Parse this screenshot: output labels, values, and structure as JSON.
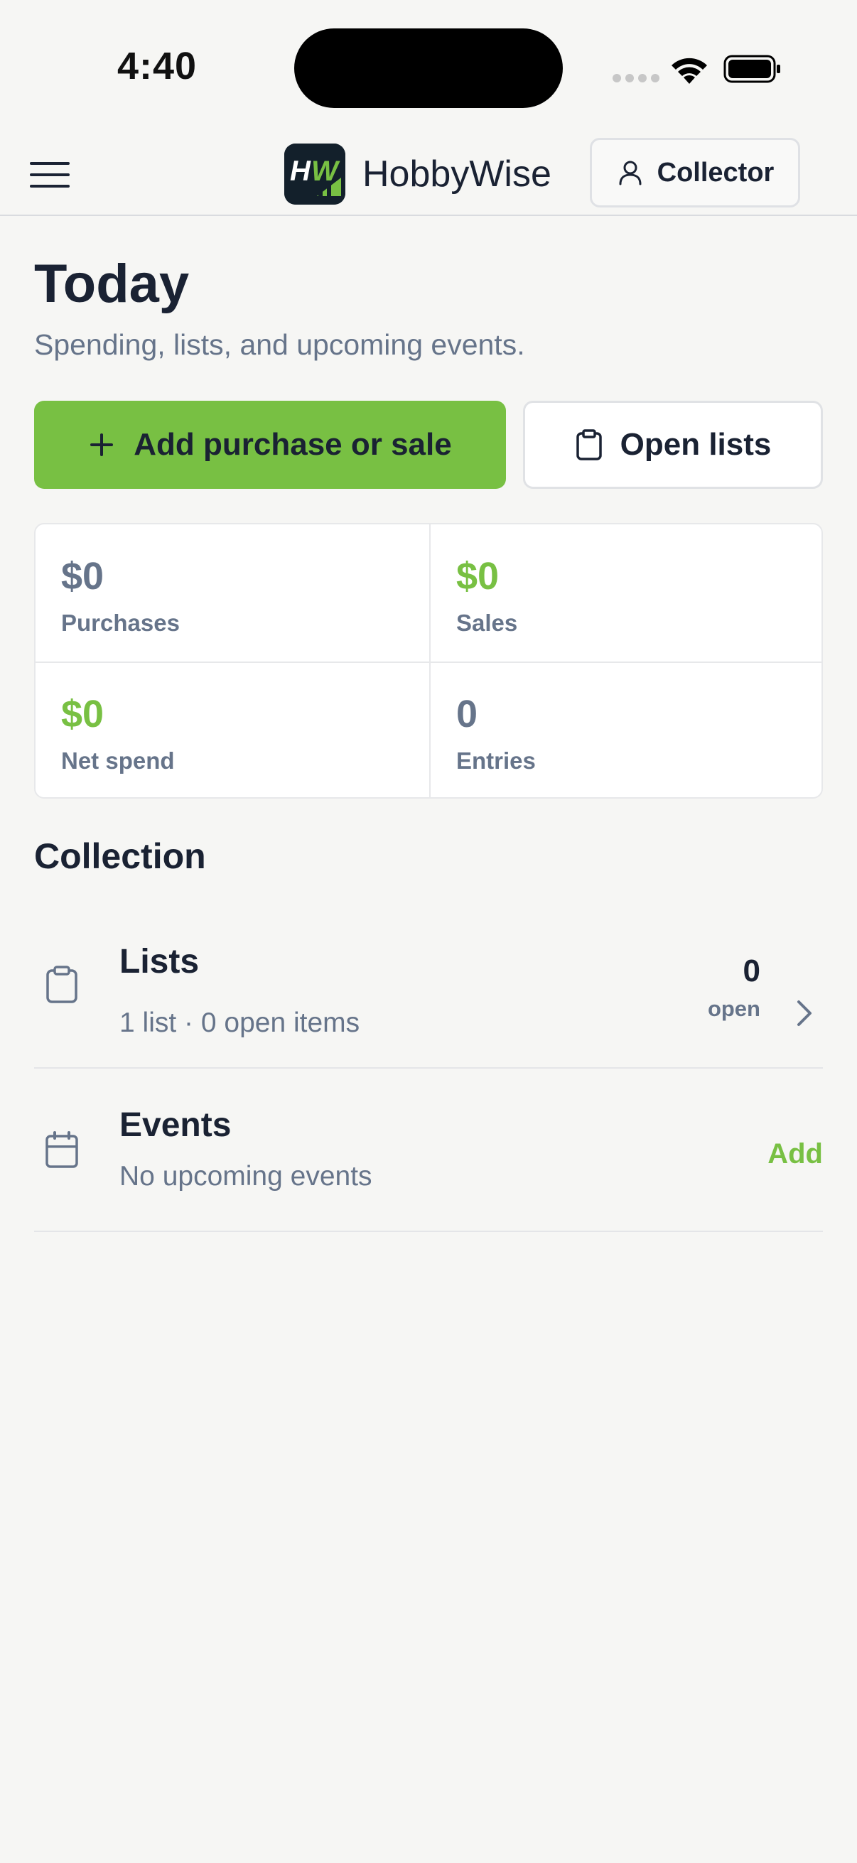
{
  "status_bar": {
    "time": "4:40",
    "icons": [
      "signal-dots-icon",
      "wifi-icon",
      "battery-icon"
    ]
  },
  "header": {
    "menu_icon": "hamburger-menu-icon",
    "logo_text": "HW",
    "app_name": "HobbyWise",
    "profile_button": {
      "icon": "user-icon",
      "label": "Collector"
    }
  },
  "page": {
    "title": "Today",
    "subtitle": "Spending, lists, and upcoming events."
  },
  "actions": {
    "primary": {
      "icon": "plus-icon",
      "label": "Add purchase or sale"
    },
    "secondary": {
      "icon": "clipboard-icon",
      "label": "Open lists"
    }
  },
  "stats": [
    {
      "value": "$0",
      "label": "Purchases",
      "color": "#66748a"
    },
    {
      "value": "$0",
      "label": "Sales",
      "color": "#78c043"
    },
    {
      "value": "$0",
      "label": "Net spend",
      "color": "#78c043"
    },
    {
      "value": "0",
      "label": "Entries",
      "color": "#66748a"
    }
  ],
  "collection": {
    "title": "Collection",
    "lists": {
      "icon": "clipboard-icon",
      "title": "Lists",
      "subtitle": "1 list · 0 open items",
      "count": "0",
      "count_label": "open",
      "chevron": "chevron-right-icon"
    },
    "events": {
      "icon": "calendar-icon",
      "title": "Events",
      "subtitle": "No upcoming events",
      "action": "Add"
    }
  },
  "colors": {
    "accent": "#78c043",
    "text_primary": "#1a2233",
    "text_secondary": "#66748a",
    "background": "#f6f6f4"
  }
}
